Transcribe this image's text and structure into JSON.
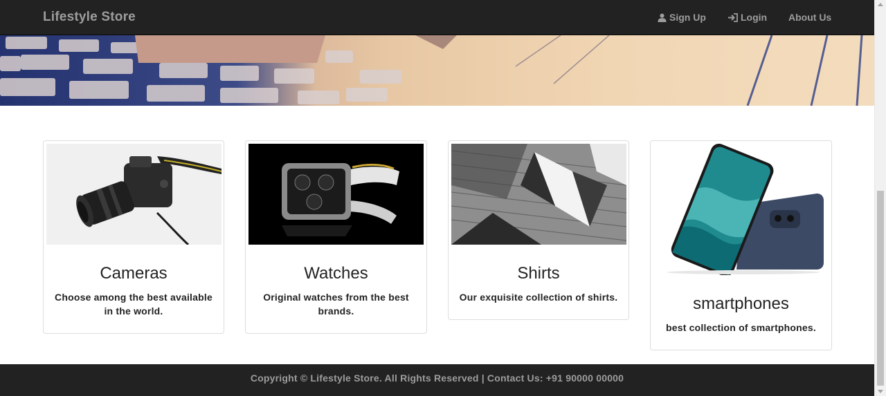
{
  "navbar": {
    "brand": "Lifestyle Store",
    "items": [
      {
        "label": "Sign Up",
        "icon": "user-icon"
      },
      {
        "label": "Login",
        "icon": "login-icon"
      },
      {
        "label": "About Us"
      }
    ]
  },
  "products": [
    {
      "title": "Cameras",
      "description": "Choose among the best available in the world.",
      "image": "camera"
    },
    {
      "title": "Watches",
      "description": "Original watches from the best brands.",
      "image": "watch"
    },
    {
      "title": "Shirts",
      "description": "Our exquisite collection of shirts.",
      "image": "shirt"
    },
    {
      "title": "smartphones",
      "description": "best collection of smartphones.",
      "image": "smartphone"
    }
  ],
  "footer": {
    "text": "Copyright © Lifestyle Store. All Rights Reserved | Contact Us: +91 90000 00000"
  },
  "colors": {
    "navbar_bg": "#222222",
    "nav_text": "#9d9d9d",
    "card_border": "#dddddd"
  }
}
